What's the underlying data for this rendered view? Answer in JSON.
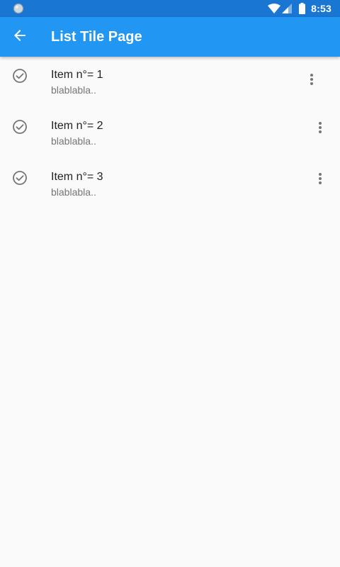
{
  "status_bar": {
    "time": "8:53",
    "left_icon": "circle-notification-icon",
    "right_icons": [
      "wifi-icon",
      "signal-icon",
      "battery-icon"
    ]
  },
  "app_bar": {
    "back_icon": "arrow-back-icon",
    "title": "List Tile Page"
  },
  "list": {
    "items": [
      {
        "title": "Item n°= 1",
        "subtitle": "blablabla..",
        "leading_icon": "check-circle-outline-icon",
        "trailing_icon": "more-vert-icon"
      },
      {
        "title": "Item n°= 2",
        "subtitle": "blablabla..",
        "leading_icon": "check-circle-outline-icon",
        "trailing_icon": "more-vert-icon"
      },
      {
        "title": "Item n°= 3",
        "subtitle": "blablabla..",
        "leading_icon": "check-circle-outline-icon",
        "trailing_icon": "more-vert-icon"
      }
    ]
  },
  "colors": {
    "status_bar": "#1976d2",
    "app_bar": "#2196f3",
    "background": "#fafafa",
    "icon_grey": "#757575",
    "title_text": "#212121",
    "subtitle_text": "#757575"
  }
}
